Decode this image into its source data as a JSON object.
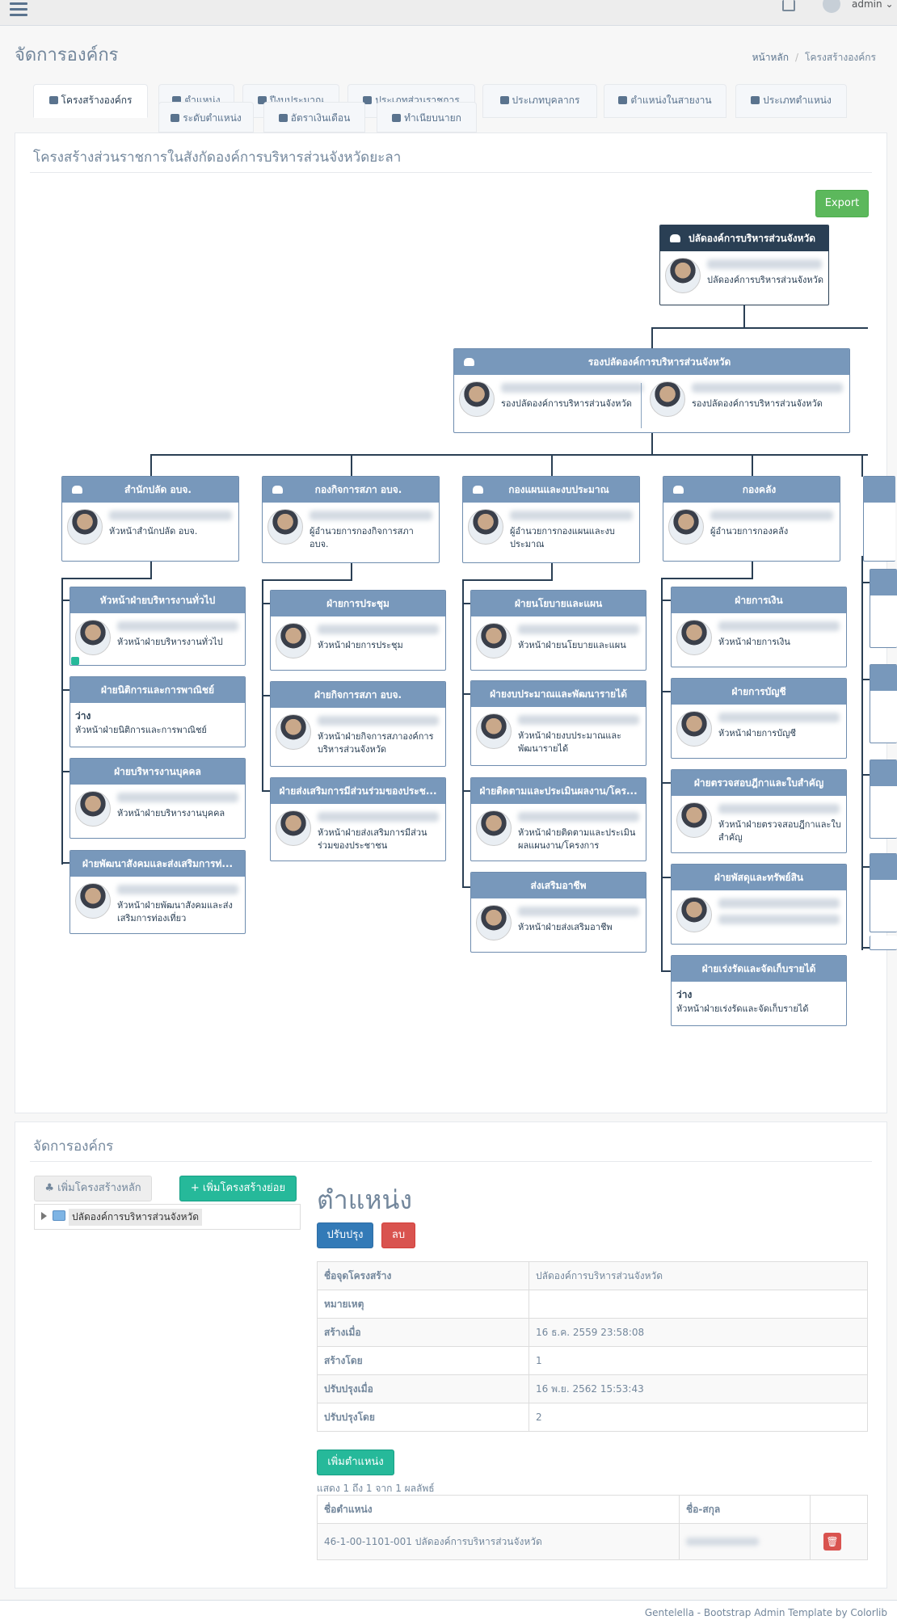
{
  "topbar": {
    "user_name": "admin"
  },
  "page": {
    "title": "จัดการองค์กร",
    "breadcrumb": [
      "หน้าหลัก",
      "โครงสร้างองค์กร"
    ]
  },
  "tabs": [
    "โครงสร้างองค์กร",
    "ตำแหน่ง",
    "ปีงบประมาณ",
    "ประเภทส่วนราชการ",
    "ประเภทบุคลากร",
    "ตำแหน่งในสายงาน",
    "ประเภทตำแหน่ง",
    "ระดับตำแหน่ง",
    "อัตราเงินเดือน",
    "ทำเนียบนายก"
  ],
  "org_panel": {
    "title": "โครงสร้างส่วนราชการในสังกัดองค์การบริหารส่วนจังหวัดยะลา",
    "export_label": "Export"
  },
  "org": {
    "top": {
      "head": "ปลัดองค์การบริหารส่วนจังหวัด",
      "title": "ปลัดองค์การบริหารส่วนจังหวัด"
    },
    "deputy": {
      "head": "รองปลัดองค์การบริหารส่วนจังหวัด",
      "title1": "รองปลัดองค์การบริหารส่วนจังหวัด",
      "title2": "รองปลัดองค์การบริหารส่วนจังหวัด"
    },
    "depts": [
      {
        "head": "สำนักปลัด อบจ.",
        "title": "หัวหน้าสำนักปลัด อบจ."
      },
      {
        "head": "กองกิจการสภา อบจ.",
        "title": "ผู้อำนวยการกองกิจการสภา อบจ."
      },
      {
        "head": "กองแผนและงบประมาณ",
        "title": "ผู้อำนวยการกองแผนและงบประมาณ"
      },
      {
        "head": "กองคลัง",
        "title": "ผู้อำนวยการกองคลัง"
      }
    ],
    "col1": [
      {
        "head": "หัวหน้าฝ่ายบริหารงานทั่วไป",
        "title": "หัวหน้าฝ่ายบริหารงานทั่วไป"
      },
      {
        "head": "ฝ่ายนิติการและการพาณิชย์",
        "vacant": "ว่าง",
        "title": "หัวหน้าฝ่ายนิติการและการพาณิชย์"
      },
      {
        "head": "ฝ่ายบริหารงานบุคคล",
        "title": "หัวหน้าฝ่ายบริหารงานบุคคล"
      },
      {
        "head": "ฝ่ายพัฒนาสังคมและส่งเสริมการท่...",
        "title": "หัวหน้าฝ่ายพัฒนาสังคมและส่งเสริมการท่องเที่ยว"
      }
    ],
    "col2": [
      {
        "head": "ฝ่ายการประชุม",
        "title": "หัวหน้าฝ่ายการประชุม"
      },
      {
        "head": "ฝ่ายกิจการสภา อบจ.",
        "title": "หัวหน้าฝ่ายกิจการสภาองค์การบริหารส่วนจังหวัด"
      },
      {
        "head": "ฝ่ายส่งเสริมการมีส่วนร่วมของประช...",
        "title": "หัวหน้าฝ่ายส่งเสริมการมีส่วนร่วมของประชาชน"
      }
    ],
    "col3": [
      {
        "head": "ฝ่ายนโยบายและแผน",
        "title": "หัวหน้าฝ่ายนโยบายและแผน"
      },
      {
        "head": "ฝ่ายงบประมาณและพัฒนารายได้",
        "title": "หัวหน้าฝ่ายงบประมาณและพัฒนารายได้"
      },
      {
        "head": "ฝ่ายติดตามและประเมินผลงาน/โคร...",
        "title": "หัวหน้าฝ่ายติดตามและประเมินผลแผนงาน/โครงการ"
      },
      {
        "head": "ส่งเสริมอาชีพ",
        "title": "หัวหน้าฝ่ายส่งเสริมอาชีพ"
      }
    ],
    "col4": [
      {
        "head": "ฝ่ายการเงิน",
        "title": "หัวหน้าฝ่ายการเงิน"
      },
      {
        "head": "ฝ่ายการบัญชี",
        "title": "หัวหน้าฝ่ายการบัญชี"
      },
      {
        "head": "ฝ่ายตรวจสอบฎีกาและใบสำคัญ",
        "title": "หัวหน้าฝ่ายตรวจสอบฎีกาและใบสำคัญ"
      },
      {
        "head": "ฝ่ายพัสดุและทรัพย์สิน",
        "title": ""
      },
      {
        "head": "ฝ่ายเร่งรัดและจัดเก็บรายได้",
        "vacant": "ว่าง",
        "title": "หัวหน้าฝ่ายเร่งรัดและจัดเก็บรายได้"
      }
    ]
  },
  "manage": {
    "title": "จัดการองค์กร",
    "add_root_label": "เพิ่มโครงสร้างหลัก",
    "add_child_label": "เพิ่มโครงสร้างย่อย",
    "tree_node": "ปลัดองค์การบริหารส่วนจังหวัด",
    "detail_title": "ตำแหน่ง",
    "update_label": "ปรับปรุง",
    "delete_label": "ลบ",
    "details": [
      {
        "k": "ชื่อจุดโครงสร้าง",
        "v": "ปลัดองค์การบริหารส่วนจังหวัด"
      },
      {
        "k": "หมายเหตุ",
        "v": ""
      },
      {
        "k": "สร้างเมื่อ",
        "v": "16 ธ.ค. 2559 23:58:08"
      },
      {
        "k": "สร้างโดย",
        "v": "1"
      },
      {
        "k": "ปรับปรุงเมื่อ",
        "v": "16 พ.ย. 2562 15:53:43"
      },
      {
        "k": "ปรับปรุงโดย",
        "v": "2"
      }
    ],
    "add_position_label": "เพิ่มตำแหน่ง",
    "paging": "แสดง 1 ถึง 1 จาก 1 ผลลัพธ์",
    "pos_headers": [
      "ชื่อตำแหน่ง",
      "ชื่อ-สกุล"
    ],
    "pos_rows": [
      {
        "pos": "46-1-00-1101-001 ปลัดองค์การบริหารส่วนจังหวัด"
      }
    ]
  },
  "footer": "Gentelella - Bootstrap Admin Template by Colorlib"
}
